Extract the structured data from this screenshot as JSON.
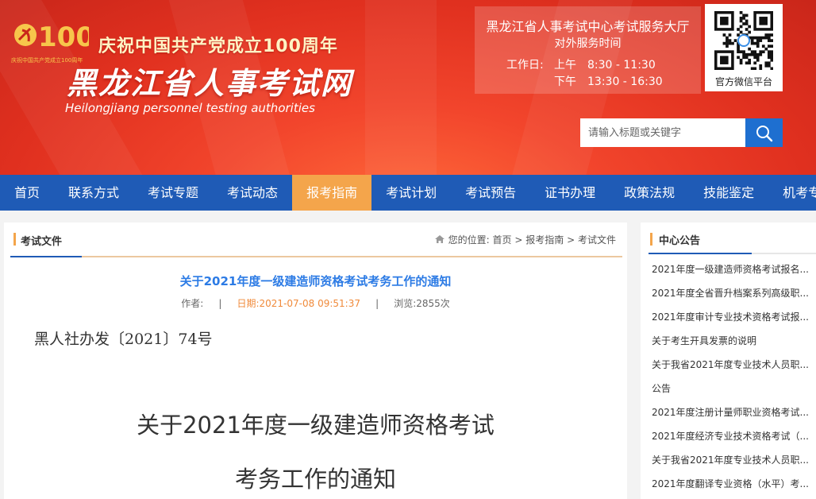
{
  "header": {
    "badge_small_text": "庆祝中国共产党成立100周年",
    "celebrate_text": "庆祝中国共产党成立100周年",
    "site_title": "黑龙江省人事考试网",
    "site_subtitle": "Heilongjiang personnel testing authorities",
    "badge_number": "100"
  },
  "service": {
    "title": "黑龙江省人事考试中心考试服务大厅",
    "subtitle": "对外服务时间",
    "hours_label": "工作日:",
    "morning": "上午　8:30 - 11:30",
    "afternoon": "下午　13:30 - 16:30"
  },
  "qr": {
    "label": "官方微信平台"
  },
  "search": {
    "placeholder": "请输入标题或关键字",
    "icon": "search-icon"
  },
  "nav": {
    "items": [
      "首页",
      "联系方式",
      "考试专题",
      "考试动态",
      "报考指南",
      "考试计划",
      "考试预告",
      "证书办理",
      "政策法规",
      "技能鉴定",
      "机考专区"
    ],
    "active": "报考指南"
  },
  "main": {
    "section_title": "考试文件",
    "breadcrumb": {
      "prefix": "您的位置:",
      "items": [
        "首页",
        "报考指南",
        "考试文件"
      ],
      "separator": ">"
    },
    "article_title": "关于2021年度一级建造师资格考试考务工作的通知",
    "meta": {
      "author_label": "作者:",
      "author": "",
      "date_label": "日期:",
      "date": "2021-07-08 09:51:37",
      "views_label": "浏览:",
      "views": "2855次",
      "separator": "|"
    },
    "doc_number": "黑人社办发〔2021〕74号",
    "heading_line1": "关于2021年度一级建造师资格考试",
    "heading_line2": "考务工作的通知"
  },
  "sidebar": {
    "title": "中心公告",
    "items": [
      "2021年度一级建造师资格考试报名...",
      "2021年度全省晋升档案系列高级职...",
      "2021年度审计专业技术资格考试报...",
      "关于考生开具发票的说明",
      "关于我省2021年度专业技术人员职...",
      "公告",
      "2021年度注册计量师职业资格考试...",
      "2021年度经济专业技术资格考试（...",
      "关于我省2021年度专业技术人员职...",
      "2021年度翻译专业资格（水平）考..."
    ]
  },
  "colors": {
    "header_red": "#e0301f",
    "nav_blue": "#1f5bb6",
    "nav_active": "#f4a54b",
    "link_blue": "#2c7be5",
    "date_orange": "#f08a3a",
    "search_button": "#1e6fd0"
  }
}
